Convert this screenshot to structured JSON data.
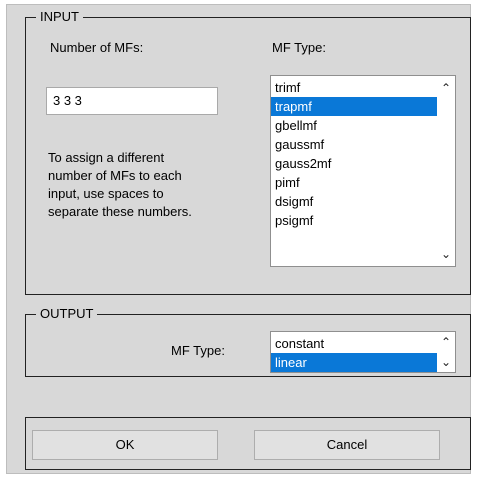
{
  "input_group": {
    "title": "INPUT",
    "num_mfs_label": "Number of MFs:",
    "num_mfs_value": "3 3 3",
    "hint_lines": [
      "To assign a different",
      "number of MFs to each",
      "input, use spaces to",
      "separate these numbers."
    ],
    "mf_type_label": "MF Type:",
    "mf_type_options": [
      "trimf",
      "trapmf",
      "gbellmf",
      "gaussmf",
      "gauss2mf",
      "pimf",
      "dsigmf",
      "psigmf"
    ],
    "mf_type_selected": "trapmf"
  },
  "output_group": {
    "title": "OUTPUT",
    "mf_type_label": "MF Type:",
    "mf_type_options": [
      "constant",
      "linear"
    ],
    "mf_type_selected": "linear"
  },
  "buttons": {
    "ok_label": "OK",
    "cancel_label": "Cancel"
  },
  "icons": {
    "scroll_up": "chevron-up-icon",
    "scroll_down": "chevron-down-icon"
  },
  "colors": {
    "selection": "#0a78d7",
    "dialog_bg": "#d8d8d8"
  }
}
